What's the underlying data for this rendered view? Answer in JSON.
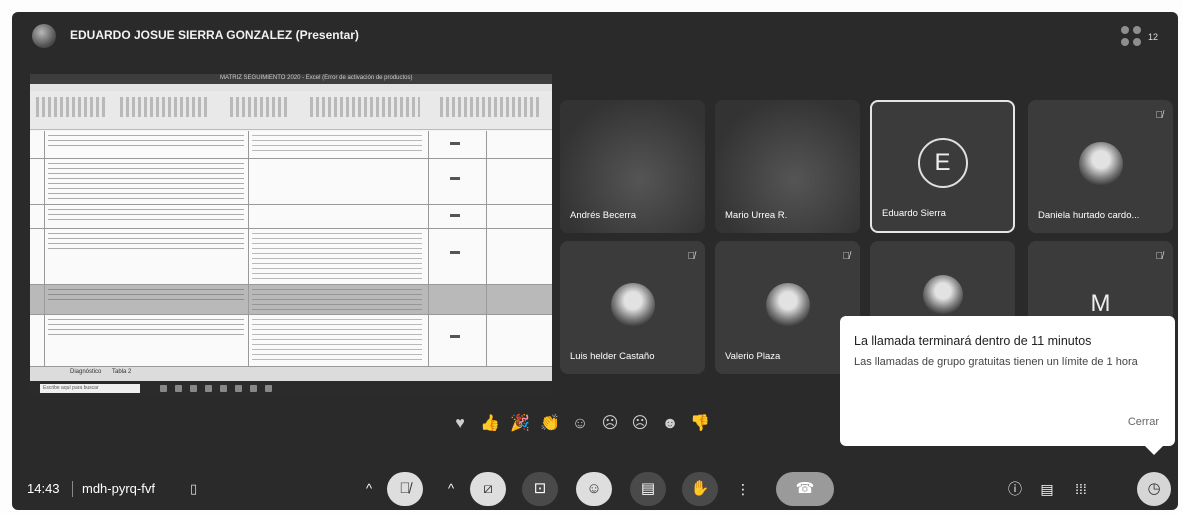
{
  "header": {
    "presenter_name": "EDUARDO JOSUE SIERRA GONZALEZ (Presentar)",
    "participant_count": "12"
  },
  "shared_screen": {
    "window_title": "MATRIZ SEGUIMIENTO 2020 - Excel (Error de activación de productos)",
    "sheet_tabs": [
      "Diagnóstico",
      "Tabla 2"
    ],
    "taskbar_search": "Escribe aquí para buscar"
  },
  "tiles": [
    {
      "name": "Andrés Becerra",
      "muted": false
    },
    {
      "name": "Mario Urrea R.",
      "muted": false
    },
    {
      "name": "Eduardo Sierra",
      "muted": false,
      "initial": "E"
    },
    {
      "name": "Daniela hurtado cardo...",
      "muted": true
    },
    {
      "name": "Luis helder Castaño",
      "muted": true
    },
    {
      "name": "Valerio Plaza",
      "muted": true
    },
    {
      "name": "",
      "muted": false
    },
    {
      "name": "",
      "muted": true,
      "initial": "M"
    }
  ],
  "reactions": [
    "heart-icon",
    "thumbs-up-icon",
    "party-popper-icon",
    "clap-icon",
    "laugh-icon",
    "surprised-icon",
    "sad-icon",
    "thinking-icon",
    "thumbs-down-icon"
  ],
  "bottom_bar": {
    "time": "14:43",
    "meeting_code": "mdh-pyrq-fvf"
  },
  "toast": {
    "title": "La llamada terminará dentro de 11 minutos",
    "body": "Las llamadas de grupo gratuitas tienen un límite de 1 hora",
    "close_label": "Cerrar"
  },
  "colors": {
    "background": "#2a2a2a",
    "tile": "#3b3b3b",
    "toast": "#ffffff"
  }
}
